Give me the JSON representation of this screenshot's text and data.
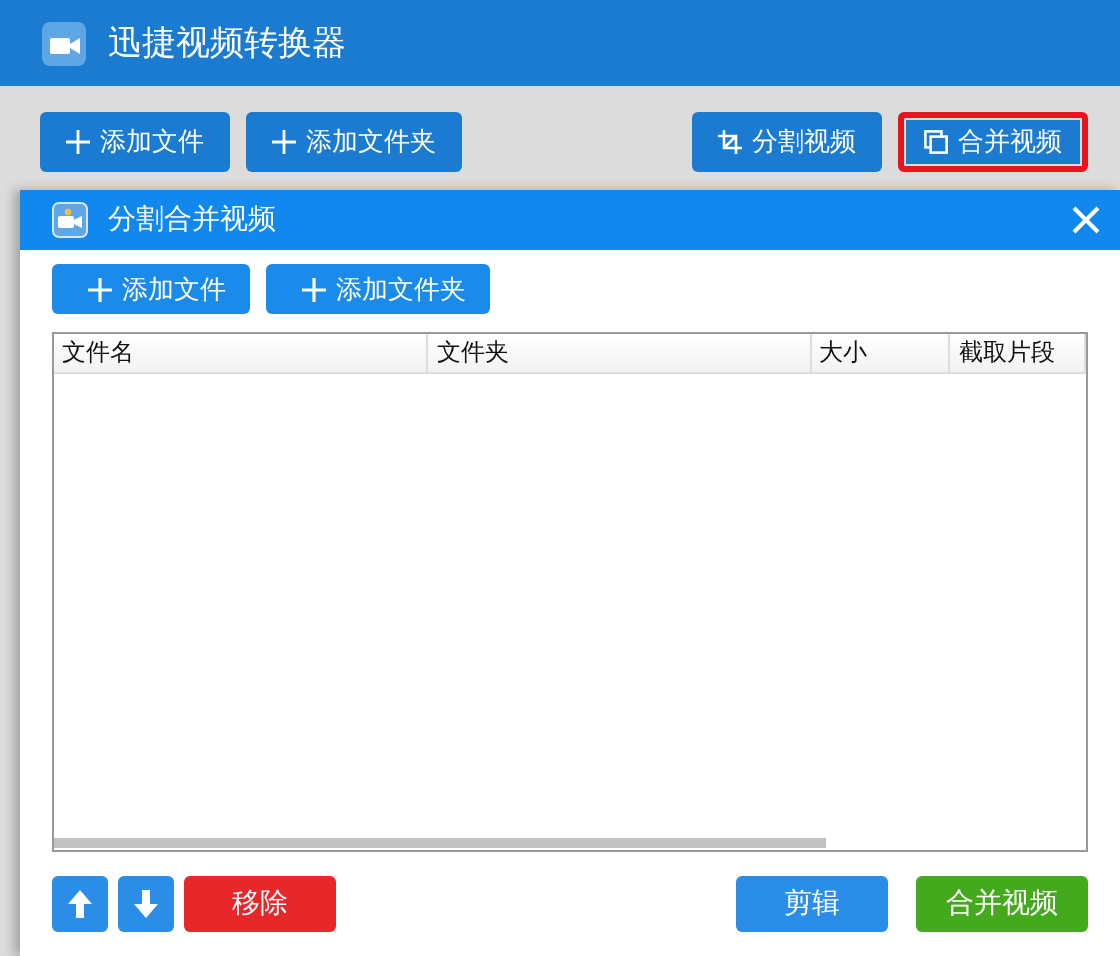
{
  "window": {
    "title": "迅捷视频转换器"
  },
  "toolbar": {
    "buttons": [
      {
        "label": "添加文件",
        "kind": "add",
        "highlighted": false
      },
      {
        "label": "添加文件夹",
        "kind": "add",
        "highlighted": false
      },
      {
        "label": "分割视频",
        "kind": "crop",
        "highlighted": false
      },
      {
        "label": "合并视频",
        "kind": "merge",
        "highlighted": true
      }
    ]
  },
  "dialog": {
    "title": "分割合并视频",
    "buttons": [
      {
        "label": "添加文件"
      },
      {
        "label": "添加文件夹"
      }
    ],
    "table": {
      "columns": [
        "文件名",
        "文件夹",
        "大小",
        "截取片段"
      ]
    },
    "footer": {
      "left": [
        {
          "kind": "up"
        },
        {
          "kind": "down"
        },
        {
          "kind": "remove",
          "label": "移除"
        }
      ],
      "right": [
        {
          "kind": "edit",
          "label": "剪辑"
        },
        {
          "kind": "merge",
          "label": "合并视频"
        }
      ]
    }
  }
}
